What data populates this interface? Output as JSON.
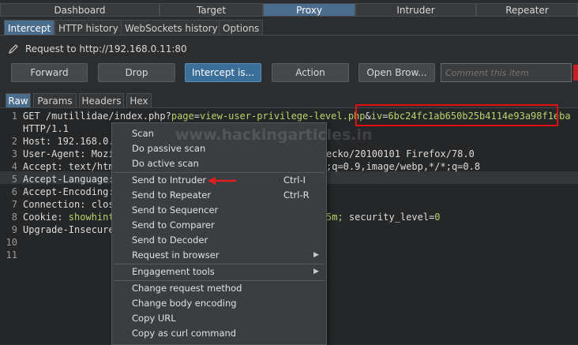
{
  "top_tabs": [
    "Dashboard",
    "Target",
    "Proxy",
    "Intruder",
    "Repeater"
  ],
  "sub_tabs": [
    "Intercept",
    "HTTP history",
    "WebSockets history",
    "Options"
  ],
  "request_info": "Request to http://192.168.0.11:80",
  "buttons": [
    "Forward",
    "Drop",
    "Intercept is...",
    "Action",
    "Open Brow..."
  ],
  "comment_placeholder": "Comment this item",
  "editor_tabs": [
    "Raw",
    "Params",
    "Headers",
    "Hex"
  ],
  "code": {
    "l1_method": "GET /mutillidae/index.php?",
    "l1_k1": "page",
    "l1_eq1": "=",
    "l1_v1": "view-user-privilege-level.php",
    "l1_amp": "&",
    "l1_k2": "iv",
    "l1_eq2": "=",
    "l1_v2": "6bc24fc1ab650b25b4114e93a98f1eba",
    "l1_cont": "HTTP/1.1",
    "l2": "Host: 192.168.0.",
    "l3_a": "User-Agent: Mozi",
    "l3_b": "ecko/20100101 Firefox/78.0",
    "l4_a": "Accept: text/htm",
    "l4_b": ";q=0.9,image/webp,*/*;q=0.8",
    "l5": "Accept-Language:",
    "l6": "Accept-Encoding:",
    "l7": "Connection: clos",
    "l8_a": "Cookie: ",
    "l8_k": "showhint",
    "l8_b": "5m; ",
    "l8_k2": "security_level",
    "l8_eq": "=",
    "l8_v": "0",
    "l9": "Upgrade-Insecure"
  },
  "line_numbers": [
    "1",
    "2",
    "3",
    "4",
    "5",
    "6",
    "7",
    "8",
    "9",
    "10",
    "11"
  ],
  "watermark": "www.hackingarticles.in",
  "menu": [
    {
      "label": "Scan",
      "shortcut": "",
      "arrow": ""
    },
    {
      "label": "Do passive scan",
      "shortcut": "",
      "arrow": ""
    },
    {
      "label": "Do active scan",
      "shortcut": "",
      "arrow": ""
    },
    {
      "label": "Send to Intruder",
      "shortcut": "Ctrl-I",
      "arrow": ""
    },
    {
      "label": "Send to Repeater",
      "shortcut": "Ctrl-R",
      "arrow": ""
    },
    {
      "label": "Send to Sequencer",
      "shortcut": "",
      "arrow": ""
    },
    {
      "label": "Send to Comparer",
      "shortcut": "",
      "arrow": ""
    },
    {
      "label": "Send to Decoder",
      "shortcut": "",
      "arrow": ""
    },
    {
      "label": "Request in browser",
      "shortcut": "",
      "arrow": "▶"
    },
    {
      "label": "Engagement tools",
      "shortcut": "",
      "arrow": "▶"
    },
    {
      "label": "Change request method",
      "shortcut": "",
      "arrow": ""
    },
    {
      "label": "Change body encoding",
      "shortcut": "",
      "arrow": ""
    },
    {
      "label": "Copy URL",
      "shortcut": "",
      "arrow": ""
    },
    {
      "label": "Copy as curl command",
      "shortcut": "",
      "arrow": ""
    }
  ],
  "colors": {
    "highlight_box": "#e01010",
    "active_tab": "#4b6c8c",
    "param_value": "#b8d46a",
    "arrow": "#e02020"
  },
  "icons": {
    "request_info": "pencil-icon",
    "submenu": "triangle-right-icon",
    "annotation": "red-arrow-icon"
  }
}
